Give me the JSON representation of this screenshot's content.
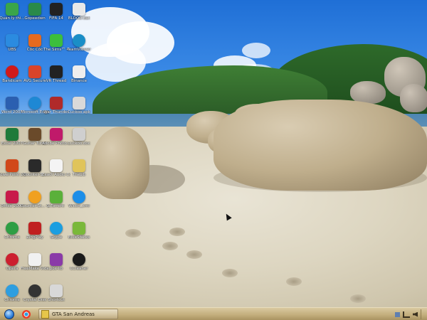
{
  "desktop": {
    "icons": [
      {
        "label": "Quản lý thi...",
        "icon": "folder-green-icon",
        "color": "#3aa54a"
      },
      {
        "label": "Gopeedwn",
        "icon": "gopeed-icon",
        "color": "#2a8a4a"
      },
      {
        "label": "FIFA 14",
        "icon": "fifa-icon",
        "color": "#222222"
      },
      {
        "label": "BLOOD.dat",
        "icon": "file-icon",
        "color": "#e8e8e8"
      },
      {
        "label": "UBS",
        "icon": "blue-app-icon",
        "color": "#2b8be0"
      },
      {
        "label": "Cốc Cốc",
        "icon": "firefox-icon",
        "color": "#e56a1f"
      },
      {
        "label": "The Sims™ 4",
        "icon": "sims-icon",
        "color": "#3cbf3c"
      },
      {
        "label": "TeamViewer",
        "icon": "teamviewer-icon",
        "color": "#1a8ec7"
      },
      {
        "label": "Bandicam",
        "icon": "record-icon",
        "color": "#d11a1a"
      },
      {
        "label": "AVG Secure",
        "icon": "avg-icon",
        "color": "#d9442a"
      },
      {
        "label": "VR Thread",
        "icon": "vr-icon",
        "color": "#222222"
      },
      {
        "label": "Binance",
        "icon": "file-icon",
        "color": "#eeeeee"
      },
      {
        "label": "Word 2007",
        "icon": "word-icon",
        "color": "#2b5fb0"
      },
      {
        "label": "Microsoft Edge",
        "icon": "edge-icon",
        "color": "#1e88d4"
      },
      {
        "label": "War Thunder",
        "icon": "warthunder-icon",
        "color": "#b02a2a"
      },
      {
        "label": "Cuckoo.apk",
        "icon": "file-icon",
        "color": "#d9d9d9"
      },
      {
        "label": "Excel 2007",
        "icon": "excel-icon",
        "color": "#1f7a3a"
      },
      {
        "label": "Guitar Tuner",
        "icon": "guitar-icon",
        "color": "#6a4a2a"
      },
      {
        "label": "Adobe Photo...",
        "icon": "photoshop-icon",
        "color": "#c01a6a"
      },
      {
        "label": "Cuckoo.doc",
        "icon": "file-icon",
        "color": "#cfcfcf"
      },
      {
        "label": "PowerPoint 2007",
        "icon": "powerpoint-icon",
        "color": "#d1481a"
      },
      {
        "label": "Counter-S...",
        "icon": "counterstrike-icon",
        "color": "#2a2a2a"
      },
      {
        "label": "Exact Audio Copy",
        "icon": "eac-icon",
        "color": "#f4f4f4"
      },
      {
        "label": "TheLib",
        "icon": "file-icon",
        "color": "#e0c45a"
      },
      {
        "label": "Office 2007",
        "icon": "office-icon",
        "color": "#c81a4a"
      },
      {
        "label": "Counter-St... Global Off...",
        "icon": "csgo-icon",
        "color": "#f0a020"
      },
      {
        "label": "uTorrent",
        "icon": "utorrent-icon",
        "color": "#5ab03a"
      },
      {
        "label": "Wicon_xml",
        "icon": "ie-icon",
        "color": "#1c8ee8"
      },
      {
        "label": "Chrome",
        "icon": "chrome-icon",
        "color": "#2e9e44"
      },
      {
        "label": "ZingPlay",
        "icon": "zingplay-icon",
        "color": "#c02020"
      },
      {
        "label": "Skype",
        "icon": "skype-icon",
        "color": "#1b9ee0"
      },
      {
        "label": "BlueStacks",
        "icon": "bluestacks-icon",
        "color": "#7ab83a"
      },
      {
        "label": "Opera",
        "icon": "opera-icon",
        "color": "#cc1f2f"
      },
      {
        "label": "FreeMake Video",
        "icon": "freemake-icon",
        "color": "#f1f1f1"
      },
      {
        "label": "pos-lib",
        "icon": "winrar-icon",
        "color": "#8a3aa8"
      },
      {
        "label": "CCleaner",
        "icon": "ccleaner-icon",
        "color": "#1a1a1a"
      },
      {
        "label": "Chrome",
        "icon": "chrome-icon",
        "color": "#2e9ee0"
      },
      {
        "label": "Crystal Disk",
        "icon": "cd-icon",
        "color": "#333333"
      },
      {
        "label": "Shortcut",
        "icon": "file-icon",
        "color": "#d8d8d8"
      }
    ]
  },
  "taskbar": {
    "start_label": "Start",
    "pinned": [
      {
        "name": "chrome",
        "icon": "chrome-icon",
        "color": "#2e9ee0"
      },
      {
        "name": "edge",
        "icon": "edge-icon",
        "color": "#1e88d4"
      }
    ],
    "active_window": "GTA San Andreas",
    "tray": {
      "icons": [
        "flag-icon",
        "network-icon",
        "volume-icon"
      ]
    }
  }
}
